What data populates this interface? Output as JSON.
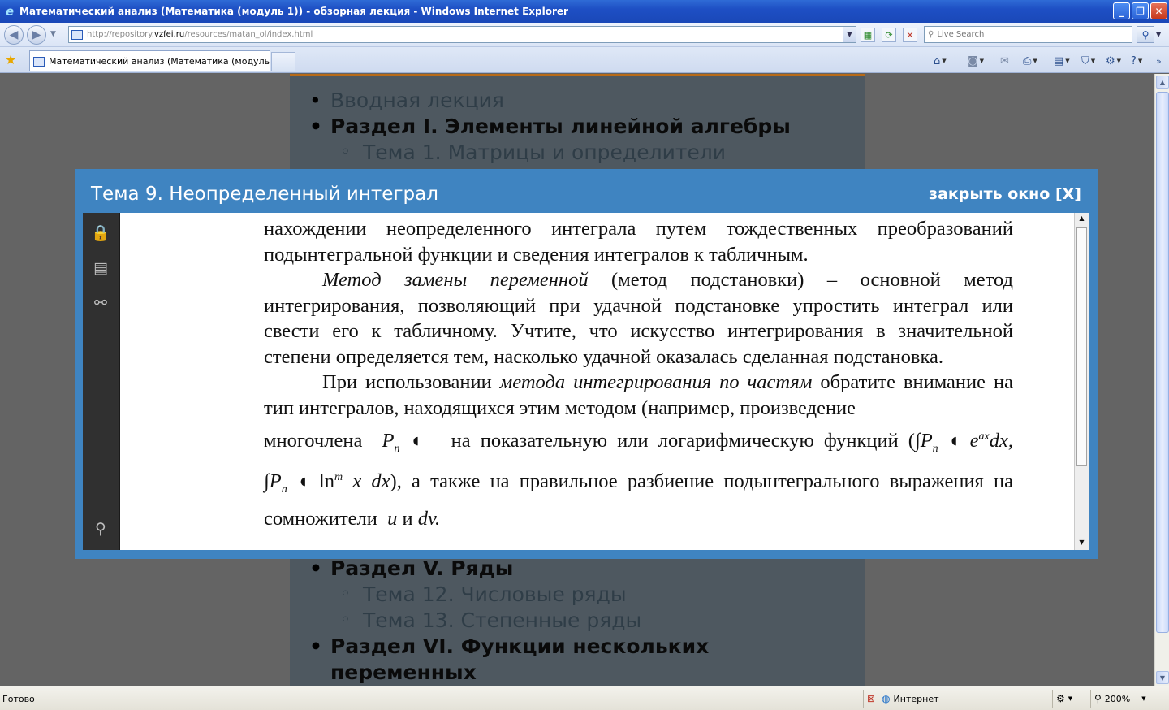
{
  "window": {
    "title": "Математический анализ (Математика (модуль 1)) - обзорная лекция - Windows Internet Explorer",
    "minimize": "_",
    "maximize": "❐",
    "close": "✕"
  },
  "address_bar": {
    "url_prefix": "http://repository.",
    "url_host": "vzfei.ru",
    "url_suffix": "/resources/matan_ol/index.html",
    "search_placeholder": "Live Search"
  },
  "tabs": [
    {
      "label": "Математический анализ (Математика (модуль 1)) ..."
    }
  ],
  "toc": {
    "items": [
      {
        "text": "Вводная лекция",
        "level": 1,
        "bold": false
      },
      {
        "text": "Раздел I. Элементы линейной алгебры",
        "level": 1,
        "bold": true
      },
      {
        "text": "Тема 1. Матрицы и определители",
        "level": 2,
        "bold": false
      }
    ],
    "items_after": [
      {
        "text": "Раздел V. Ряды",
        "level": 1,
        "bold": true
      },
      {
        "text": "Тема 12. Числовые ряды",
        "level": 2,
        "bold": false
      },
      {
        "text": "Тема 13. Степенные ряды",
        "level": 2,
        "bold": false
      },
      {
        "text": "Раздел VI. Функции нескольких переменных",
        "level": 1,
        "bold": true
      }
    ]
  },
  "modal": {
    "title": "Тема 9. Неопределенный интеграл",
    "close_label": "закрыть окно [X]",
    "doc": {
      "p1": "нахождении неопределенного интеграла путем тождественных преобразований подынтегральной функции и сведения интегралов к табличным.",
      "p2_italic": "Метод замены переменной",
      "p2_rest": " (метод подстановки) – основной метод интегрирования, позволяющий при удачной подстановке упростить интеграл или свести его к табличному. Учтите, что искусство интегрирования в значительной степени определяется тем, насколько удачной оказалась сделанная подстановка.",
      "p3_start": "При использовании ",
      "p3_italic": "метода интегрирования по частям",
      "p3_rest": " обратите внимание на тип интегралов, находящихся этим методом (например, произведение",
      "p4_a": "многочлена",
      "p4_b": "на показательную или логарифмическую функций (",
      "p5_b": "), а также на правильное разбиение подынтегрального выражения на",
      "p6_a": "сомножители",
      "p6_and": "и",
      "math_Pn": "P",
      "math_n": "n",
      "math_e": "e",
      "math_ax": "ax",
      "math_dx": "dx,",
      "math_ln": "ln",
      "math_m": "m",
      "math_xdx": "x dx",
      "math_u": "u",
      "math_dv": "dv."
    }
  },
  "statusbar": {
    "status": "Готово",
    "zone": "Интернет",
    "zoom": "200%"
  },
  "colors": {
    "modal_bg": "#3f84c1",
    "page_bg": "#4e5860",
    "accent_line": "#b86a17"
  }
}
